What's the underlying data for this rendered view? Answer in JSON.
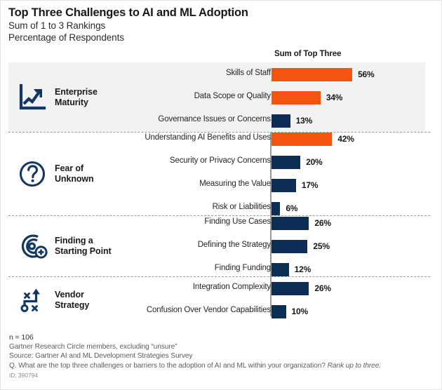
{
  "header": {
    "title": "Top Three Challenges to AI and ML Adoption",
    "subtitle_1": "Sum of 1 to 3 Rankings",
    "subtitle_2": "Percentage of Respondents",
    "column_header": "Sum of Top Three"
  },
  "colors": {
    "orange": "#f4540e",
    "navy": "#0c2d56",
    "band": "#f2f2f2",
    "axis": "#9b9b9b"
  },
  "categories": [
    {
      "label": "Enterprise\nMaturity",
      "icon": "line-chart-growth-icon"
    },
    {
      "label": "Fear of\nUnknown",
      "icon": "question-mark-circle-icon"
    },
    {
      "label": "Finding a\nStarting Point",
      "icon": "target-plus-icon"
    },
    {
      "label": "Vendor\nStrategy",
      "icon": "strategy-path-icon"
    }
  ],
  "footnotes": {
    "n": "n = 106",
    "line_2": "Gartner Research Circle members, excluding “unsure”",
    "line_3": "Source: Gartner AI and ML Development Strategies Survey",
    "line_4_a": "Q. What are the top three challenges or barriers to the adoption of AI and ML within your organization? ",
    "line_4_b": "Rank up to three.",
    "id": "ID: 390794"
  },
  "chart_data": {
    "type": "bar",
    "orientation": "horizontal",
    "title": "Top Three Challenges to AI and ML Adoption",
    "subtitle": "Sum of 1 to 3 Rankings / Percentage of Respondents",
    "xlabel": "Sum of Top Three",
    "ylabel": "",
    "grid": false,
    "legend": "none",
    "xlim": [
      0,
      60
    ],
    "value_suffix": "%",
    "groups": [
      {
        "group": "Enterprise Maturity",
        "categories": [
          "Skills of Staff",
          "Data Scope or Quality",
          "Governance Issues or Concerns"
        ],
        "values": [
          56,
          34,
          13
        ],
        "labels": [
          "56%",
          "34%",
          "13%"
        ],
        "colors": [
          "#f4540e",
          "#f4540e",
          "#0c2d56"
        ]
      },
      {
        "group": "Fear of Unknown",
        "categories": [
          "Understanding AI Benefits and Uses",
          "Security or Privacy Concerns",
          "Measuring the Value",
          "Risk or Liabilities"
        ],
        "values": [
          42,
          20,
          17,
          6
        ],
        "labels": [
          "42%",
          "20%",
          "17%",
          "6%"
        ],
        "colors": [
          "#f4540e",
          "#0c2d56",
          "#0c2d56",
          "#0c2d56"
        ]
      },
      {
        "group": "Finding a Starting Point",
        "categories": [
          "Finding Use Cases",
          "Defining the Strategy",
          "Finding Funding"
        ],
        "values": [
          26,
          25,
          12
        ],
        "labels": [
          "26%",
          "25%",
          "12%"
        ],
        "colors": [
          "#0c2d56",
          "#0c2d56",
          "#0c2d56"
        ]
      },
      {
        "group": "Vendor Strategy",
        "categories": [
          "Integration Complexity",
          "Confusion Over Vendor Capabilities"
        ],
        "values": [
          26,
          10
        ],
        "labels": [
          "26%",
          "10%"
        ],
        "colors": [
          "#0c2d56",
          "#0c2d56"
        ]
      }
    ]
  }
}
